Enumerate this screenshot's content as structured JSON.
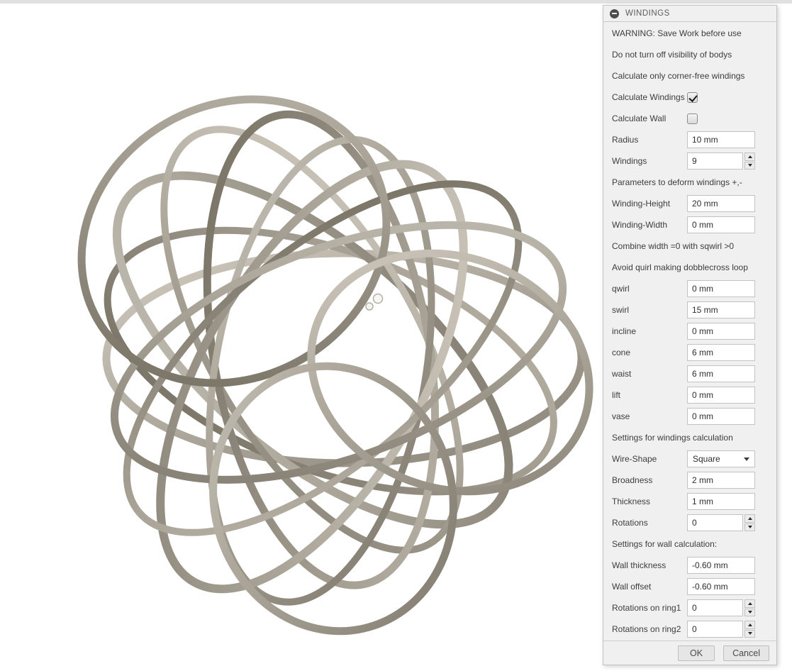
{
  "colors": {
    "top_strip": "#e0e0e0",
    "dialog_bg": "#f0f0f0",
    "dialog_border": "#c3c3c3",
    "field_border": "#c2c2c2",
    "band_light": "#cfc9be",
    "band_mid": "#9a948a",
    "band_dark": "#6d6759"
  },
  "icons": {
    "collapse": "minus-circle-icon",
    "dropdown_caret": "caret-down-icon",
    "spinner_up": "caret-up-icon",
    "spinner_down": "caret-down-icon",
    "origin_marker": "origin-dots-icon"
  },
  "dialog": {
    "title": "WINDINGS",
    "notes": [
      "WARNING: Save Work before use",
      "Do not turn off visibility of bodys",
      "Calculate only corner-free windings"
    ],
    "sections": {
      "deform": "Parameters to deform windings +,-",
      "combine": "Combine width =0 with sqwirl >0",
      "avoid": "Avoid quirl making dobblecross loop",
      "windings_calc": "Settings for windings calculation",
      "wall_calc": "Settings for wall calculation:"
    },
    "rows": {
      "calc_windings": {
        "label": "Calculate Windings",
        "checked": true
      },
      "calc_wall": {
        "label": "Calculate Wall",
        "checked": false
      },
      "radius": {
        "label": "Radius",
        "value": "10 mm"
      },
      "windings": {
        "label": "Windings",
        "value": "9"
      },
      "winding_height": {
        "label": "Winding-Height",
        "value": "20 mm"
      },
      "winding_width": {
        "label": "Winding-Width",
        "value": "0 mm"
      },
      "qwirl": {
        "label": "qwirl",
        "value": "0 mm"
      },
      "swirl": {
        "label": "swirl",
        "value": "15 mm"
      },
      "incline": {
        "label": "incline",
        "value": "0 mm"
      },
      "cone": {
        "label": "cone",
        "value": "6 mm"
      },
      "waist": {
        "label": "waist",
        "value": "6 mm"
      },
      "lift": {
        "label": "lift",
        "value": "0 mm"
      },
      "vase": {
        "label": "vase",
        "value": "0 mm"
      },
      "wire_shape": {
        "label": "Wire-Shape",
        "value": "Square"
      },
      "broadness": {
        "label": "Broadness",
        "value": "2 mm"
      },
      "thickness": {
        "label": "Thickness",
        "value": "1 mm"
      },
      "rotations": {
        "label": "Rotations",
        "value": "0"
      },
      "wall_thickness": {
        "label": "Wall thickness",
        "value": "-0.60 mm"
      },
      "wall_offset": {
        "label": "Wall offset",
        "value": "-0.60 mm"
      },
      "rot_ring1": {
        "label": "Rotations on ring1",
        "value": "0"
      },
      "rot_ring2": {
        "label": "Rotations on ring2",
        "value": "0"
      }
    },
    "buttons": {
      "ok": "OK",
      "cancel": "Cancel"
    }
  }
}
